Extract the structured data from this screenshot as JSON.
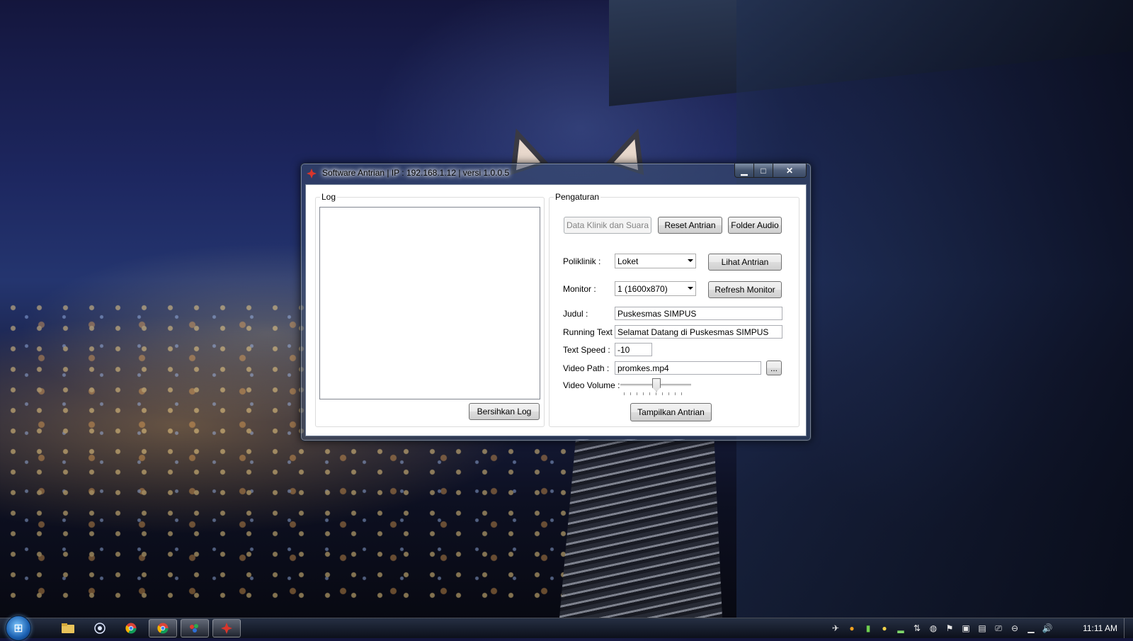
{
  "window": {
    "title": "Software Antrian | IP : 192.168.1.12 | versi 1.0.0.5",
    "minimize": "▁",
    "maximize": "□",
    "close": "✕"
  },
  "log": {
    "group_title": "Log",
    "content": "",
    "clear_button": "Bersihkan Log"
  },
  "settings": {
    "group_title": "Pengaturan",
    "buttons": {
      "data_klinik": "Data Klinik dan Suara",
      "reset_antrian": "Reset Antrian",
      "folder_audio": "Folder Audio",
      "lihat_antrian": "Lihat Antrian",
      "refresh_monitor": "Refresh Monitor",
      "browse": "...",
      "tampilkan_antrian": "Tampilkan Antrian"
    },
    "poliklinik": {
      "label": "Poliklinik :",
      "value": "Loket"
    },
    "monitor": {
      "label": "Monitor :",
      "value": "1 (1600x870)"
    },
    "judul": {
      "label": "Judul :",
      "value": "Puskesmas SIMPUS"
    },
    "running_text": {
      "label": "Running Text :",
      "value": "Selamat Datang di Puskesmas SIMPUS"
    },
    "text_speed": {
      "label": "Text Speed :",
      "value": "-10"
    },
    "video_path": {
      "label": "Video Path :",
      "value": "promkes.mp4"
    },
    "video_volume": {
      "label": "Video Volume :",
      "level": 0.5
    }
  },
  "taskbar": {
    "start_icon": "windows-logo",
    "apps": [
      "file-explorer-icon",
      "network-icon",
      "chrome-icon",
      "chrome-icon",
      "paint-icon",
      "antrian-app-icon"
    ],
    "clock": "11:11 AM"
  },
  "colors": {
    "window_frame": "#3c4e6e",
    "client_bg": "#ffffff",
    "taskbar": "#1a2130"
  }
}
